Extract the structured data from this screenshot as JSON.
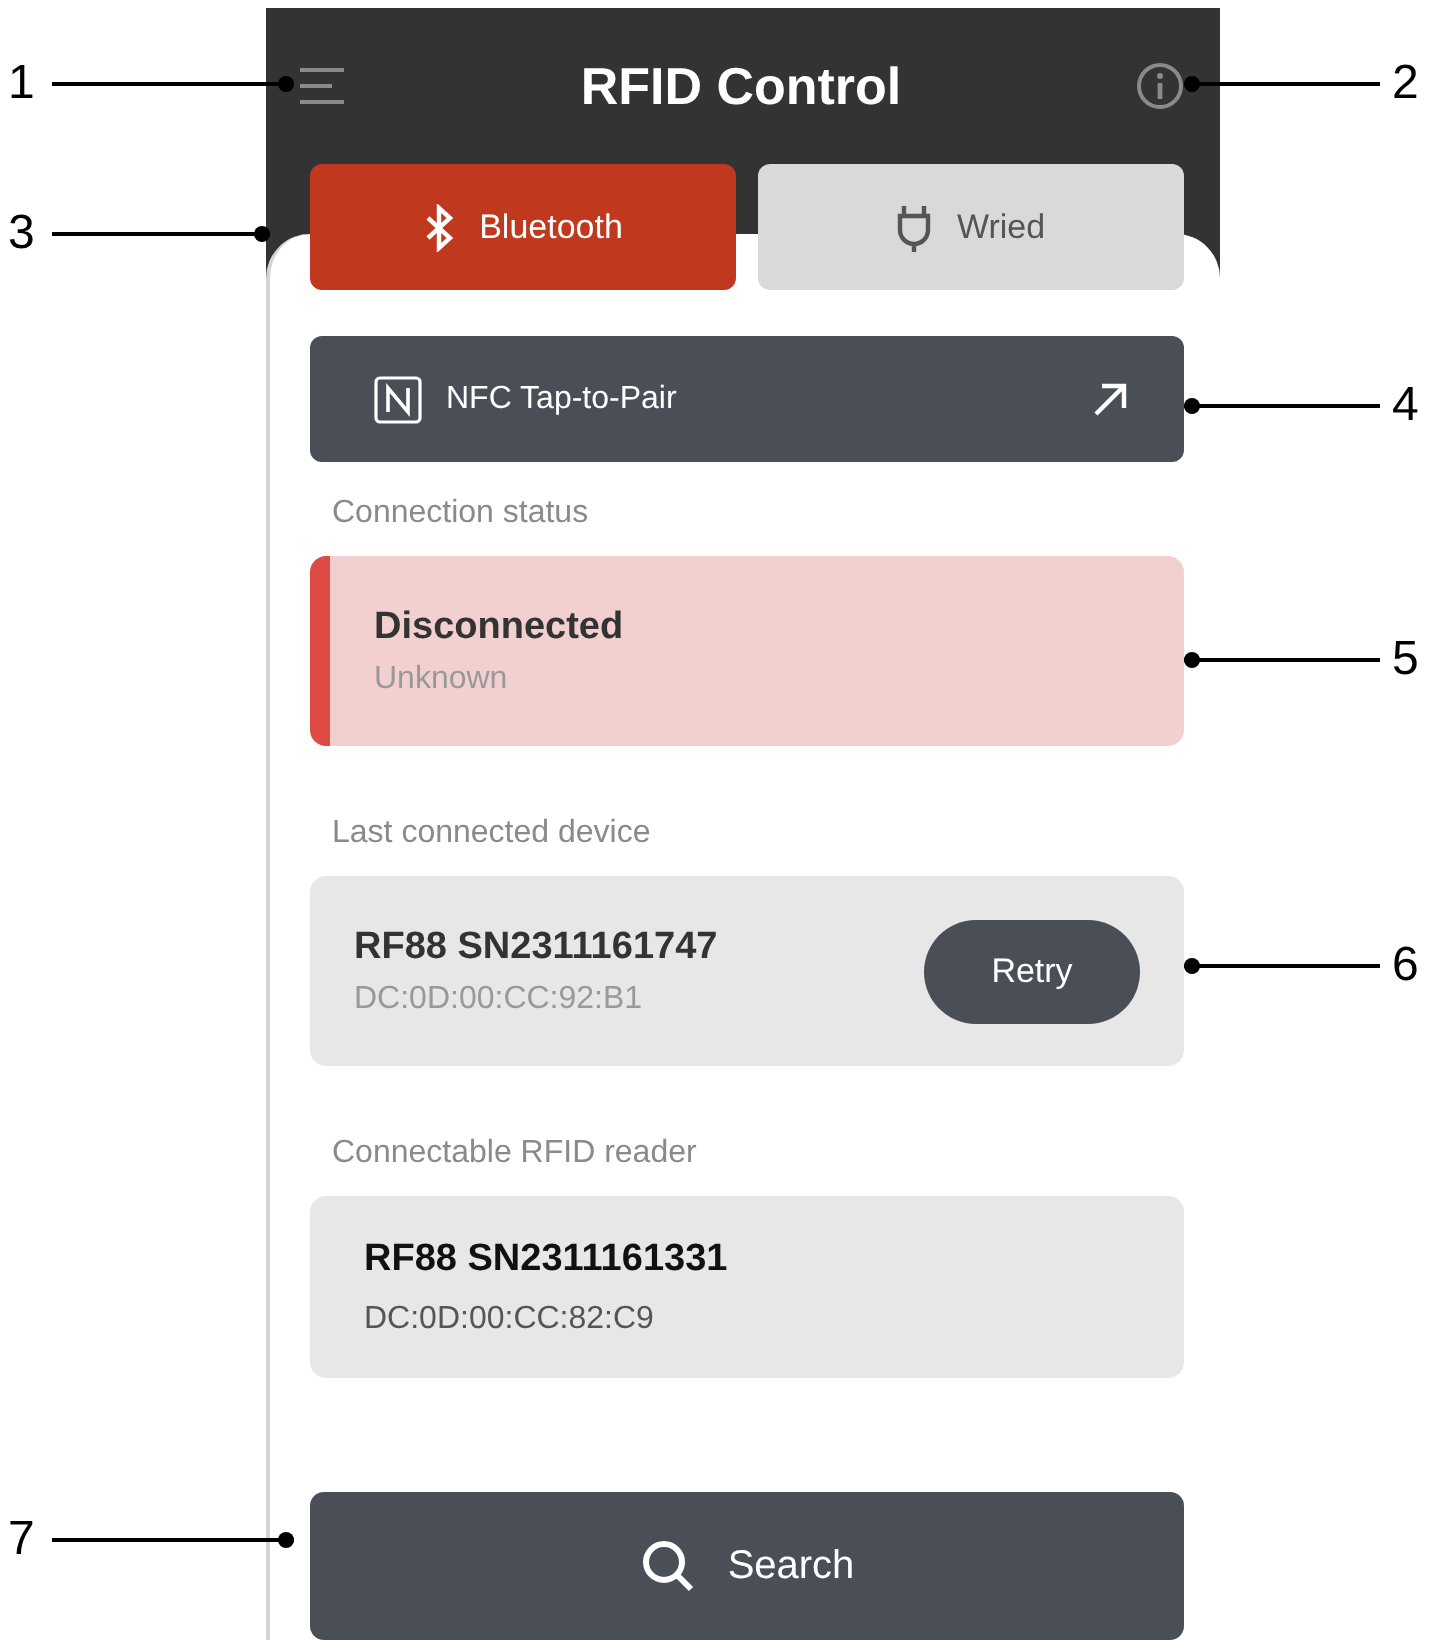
{
  "header": {
    "title": "RFID Control"
  },
  "tabs": [
    {
      "label": "Bluetooth",
      "kind": "bluetooth",
      "selected": true
    },
    {
      "label": "Wried",
      "kind": "wired",
      "selected": false
    }
  ],
  "nfc_button": {
    "label": "NFC Tap-to-Pair"
  },
  "connection_status": {
    "heading": "Connection status",
    "state": "Disconnected",
    "detail": "Unknown"
  },
  "last_device": {
    "heading": "Last connected device",
    "name": "RF88 SN2311161747",
    "address": "DC:0D:00:CC:92:B1",
    "action": "Retry"
  },
  "readers": {
    "heading": "Connectable RFID reader",
    "items": [
      {
        "name": "RF88 SN2311161331",
        "address": "DC:0D:00:CC:82:C9"
      }
    ]
  },
  "search_button": {
    "label": "Search"
  },
  "callouts": [
    "1",
    "2",
    "3",
    "4",
    "5",
    "6",
    "7"
  ]
}
